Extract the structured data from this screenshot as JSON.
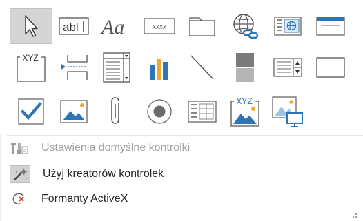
{
  "gallery": {
    "rows": [
      [
        {
          "name": "select-pointer-icon",
          "tooltip": "",
          "text": "",
          "selected": true
        },
        {
          "name": "text-box-icon",
          "text": "abl"
        },
        {
          "name": "label-icon",
          "text": "Aa"
        },
        {
          "name": "button-icon",
          "text": "xxxx"
        },
        {
          "name": "tab-control-icon",
          "text": ""
        },
        {
          "name": "hyperlink-icon",
          "text": ""
        },
        {
          "name": "web-browser-control-icon",
          "text": ""
        },
        {
          "name": "navigation-control-icon",
          "text": ""
        }
      ],
      [
        {
          "name": "option-group-icon",
          "text": "XYZ"
        },
        {
          "name": "page-break-icon",
          "text": ""
        },
        {
          "name": "combo-box-icon",
          "text": ""
        },
        {
          "name": "chart-icon",
          "text": ""
        },
        {
          "name": "line-icon",
          "text": ""
        },
        {
          "name": "toggle-button-icon",
          "text": ""
        },
        {
          "name": "list-box-icon",
          "text": ""
        },
        {
          "name": "rectangle-icon",
          "text": ""
        }
      ],
      [
        {
          "name": "check-box-icon",
          "text": ""
        },
        {
          "name": "unbound-object-frame-icon",
          "text": ""
        },
        {
          "name": "attachment-icon",
          "text": ""
        },
        {
          "name": "option-button-icon",
          "text": ""
        },
        {
          "name": "subform-icon",
          "text": ""
        },
        {
          "name": "bound-object-frame-icon",
          "text": "XYZ"
        },
        {
          "name": "image-icon",
          "text": ""
        }
      ]
    ]
  },
  "menu": {
    "items": [
      {
        "label": "Ustawienia domyślne kontrolki",
        "icon": "control-defaults-icon",
        "disabled": true
      },
      {
        "label": "Użyj kreatorów kontrolek",
        "icon": "control-wizards-icon",
        "disabled": false
      },
      {
        "label": "Formanty ActiveX",
        "icon": "activex-icon",
        "disabled": false
      }
    ]
  },
  "colors": {
    "accent_blue": "#2e75b6",
    "icon_gray": "#6d6d6d",
    "selected_bg": "#d5d5d5",
    "chart_blue": "#2e75b6",
    "chart_orange": "#f0a830"
  }
}
